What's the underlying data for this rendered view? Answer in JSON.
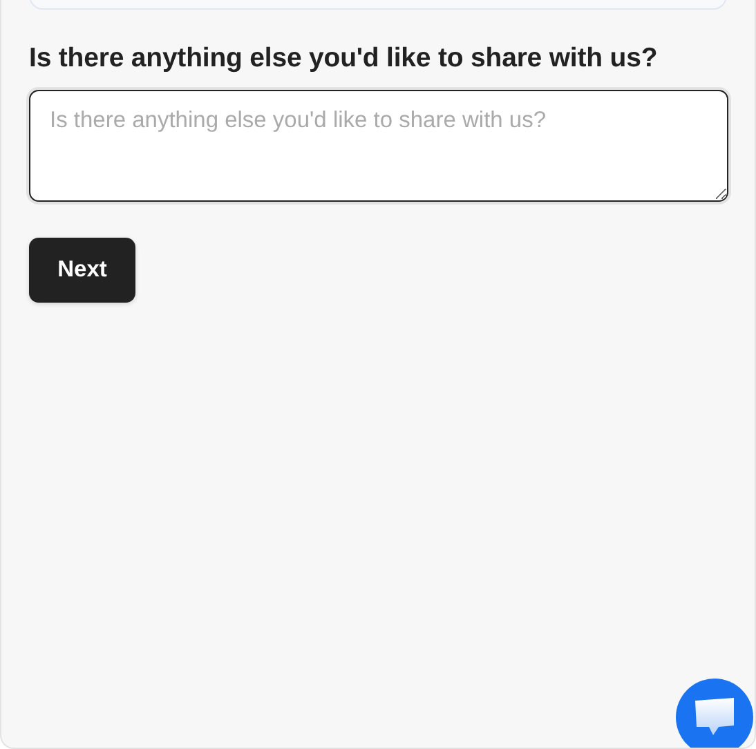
{
  "question": {
    "label": "Is there anything else you'd like to share with us?",
    "placeholder": "Is there anything else you'd like to share with us?"
  },
  "buttons": {
    "next": "Next"
  }
}
